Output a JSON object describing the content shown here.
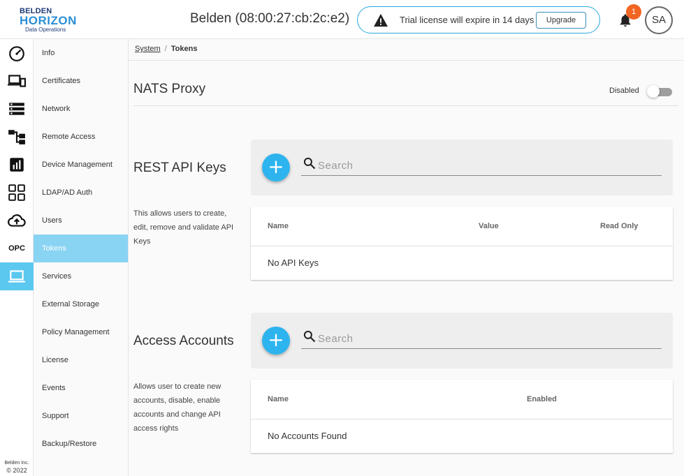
{
  "header": {
    "logo": {
      "line1": "BELDEN",
      "line2": "HORIZON",
      "line3": "Data Operations"
    },
    "device_title": "Belden (08:00:27:cb:2c:e2)",
    "trial_message": "Trial license will expire in 14 days",
    "upgrade_label": "Upgrade",
    "notification_count": "1",
    "user_initials": "SA"
  },
  "rail": {
    "items": [
      {
        "icon": "dashboard-gauge-icon"
      },
      {
        "icon": "devices-icon"
      },
      {
        "icon": "list-icon"
      },
      {
        "icon": "hierarchy-icon"
      },
      {
        "icon": "analytics-chart-icon"
      },
      {
        "icon": "apps-grid-icon"
      },
      {
        "icon": "cloud-upload-icon"
      },
      {
        "label": "OPC"
      },
      {
        "icon": "laptop-icon",
        "active": true
      }
    ],
    "copyright_line1": "Belden Inc.",
    "copyright_line2": "© 2022"
  },
  "subnav": {
    "items": [
      {
        "label": "Info"
      },
      {
        "label": "Certificates"
      },
      {
        "label": "Network"
      },
      {
        "label": "Remote Access"
      },
      {
        "label": "Device Management"
      },
      {
        "label": "LDAP/AD Auth"
      },
      {
        "label": "Users"
      },
      {
        "label": "Tokens",
        "active": true
      },
      {
        "label": "Services"
      },
      {
        "label": "External Storage"
      },
      {
        "label": "Policy Management"
      },
      {
        "label": "License"
      },
      {
        "label": "Events"
      },
      {
        "label": "Support"
      },
      {
        "label": "Backup/Restore"
      }
    ]
  },
  "breadcrumb": {
    "parent": "System",
    "separator": "/",
    "current": "Tokens"
  },
  "nats": {
    "title": "NATS Proxy",
    "toggle_label": "Disabled",
    "enabled": false
  },
  "api_keys": {
    "title": "REST API Keys",
    "description": "This allows users to create, edit, remove and validate API Keys",
    "add_symbol": "+",
    "search_placeholder": "Search",
    "columns": [
      "Name",
      "Value",
      "Read Only"
    ],
    "empty_text": "No API Keys"
  },
  "accounts": {
    "title": "Access Accounts",
    "description": "Allows user to create new accounts, disable, enable accounts and change API access rights",
    "add_symbol": "+",
    "search_placeholder": "Search",
    "columns": [
      "Name",
      "Enabled"
    ],
    "empty_text": "No Accounts Found"
  },
  "colors": {
    "accent": "#2db4ef",
    "rail_active": "#5bc8f0",
    "subnav_active": "#89d3f3",
    "badge": "#f26522",
    "trial_border": "#2aa9e0"
  }
}
